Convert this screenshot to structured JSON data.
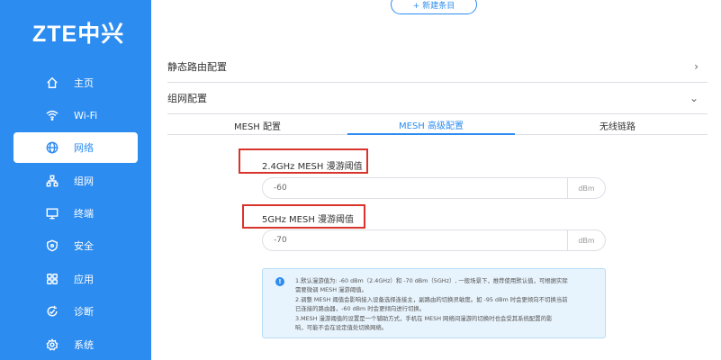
{
  "brand": {
    "logo_text": "ZTE中兴"
  },
  "sidebar": {
    "items": [
      {
        "label": "主页",
        "icon": "home-icon"
      },
      {
        "label": "Wi-Fi",
        "icon": "wifi-icon"
      },
      {
        "label": "网络",
        "icon": "globe-icon",
        "active": true
      },
      {
        "label": "组网",
        "icon": "mesh-icon"
      },
      {
        "label": "终端",
        "icon": "monitor-icon"
      },
      {
        "label": "安全",
        "icon": "shield-icon"
      },
      {
        "label": "应用",
        "icon": "apps-icon"
      },
      {
        "label": "诊断",
        "icon": "diagnose-icon"
      },
      {
        "label": "系统",
        "icon": "gear-icon"
      }
    ]
  },
  "main": {
    "new_entry_button": "+ 新建条目",
    "sections": [
      {
        "label": "静态路由配置",
        "chevron": "›"
      },
      {
        "label": "组网配置",
        "chevron": "⌄"
      }
    ],
    "tabs": [
      {
        "label": "MESH 配置"
      },
      {
        "label": "MESH 高级配置",
        "active": true
      },
      {
        "label": "无线链路"
      }
    ],
    "fields": [
      {
        "label": "2.4GHz MESH 漫游阈值",
        "value": "-60",
        "unit": "dBm"
      },
      {
        "label": "5GHz MESH 漫游阈值",
        "value": "-70",
        "unit": "dBm"
      }
    ],
    "info": {
      "icon": "info-icon",
      "lines": [
        "1.默认漫游值为: -60 dBm（2.4GHz）和 -70 dBm（5GHz）, 一般场景下，推荐使用默认值，可根据实际",
        "需要微调 MESH 漫游阈值。",
        "2.调整 MESH 阈值会影响接入设备选择连接主，副路由的切换灵敏度。如 -95 dBm 时会更倾向不切换当前",
        "已连接的路由器，-60 dBm 时会更倾向进行切换。",
        "3.MESH 漫游阈值的设置是一个辅助方式，手机在 MESH 网络间漫游的切换时也会受其系统配置的影",
        "响，可能不会在设定值处切换网络。"
      ]
    }
  },
  "colors": {
    "accent": "#2d8cf0",
    "highlight": "#d9342b"
  }
}
